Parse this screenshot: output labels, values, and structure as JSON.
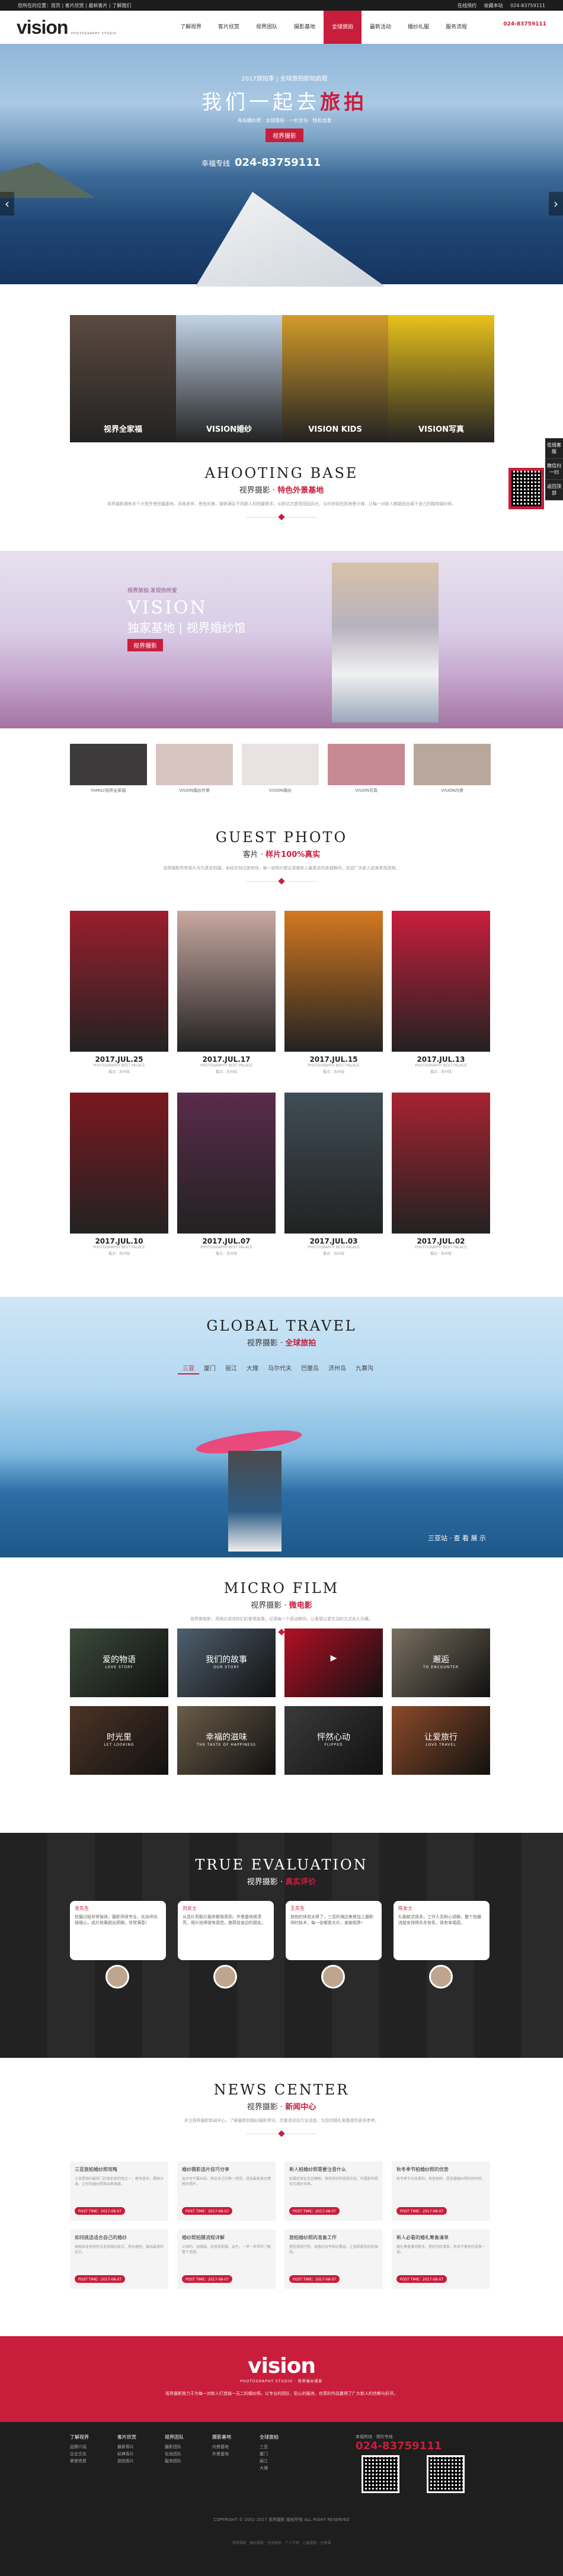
{
  "topbar": {
    "left": "您所在的位置：首页 | 客片欣赏 | 最新客片 | 了解我们",
    "links": [
      "在线预约",
      "收藏本站",
      "024-83759111"
    ]
  },
  "header": {
    "logo": "vision",
    "logo_sub": "PHOTOGRAPHY STUDIO",
    "nav": [
      "了解视界",
      "客片欣赏",
      "视界团队",
      "摄影基地",
      "全球旅拍",
      "最新活动",
      "婚纱礼服",
      "服务流程"
    ],
    "nav_active_index": 4,
    "phone": "024-83759111"
  },
  "hero": {
    "small": "2017旅拍季 | 全球旅拍即刻启程",
    "title_a": "我们一起去",
    "title_b": "旅拍",
    "line": "海岛婚纱照 · 全球旅拍 · 一价全包 · 轻松出发",
    "btn": "视界摄影",
    "phone_label": "幸福专线",
    "phone": "024-83759111",
    "prev": "‹",
    "next": "›"
  },
  "categories": [
    {
      "label": "视界全家福",
      "bg": "#5b4a40"
    },
    {
      "label": "VISION婚纱",
      "bg": "#c3d4e8"
    },
    {
      "label": "VISION KIDS",
      "bg": "#d39c2a"
    },
    {
      "label": "VISION写真",
      "bg": "#e9c21b"
    }
  ],
  "float_side": [
    "在线客服",
    "微信扫一扫",
    "返回顶部"
  ],
  "shooting": {
    "en": "AHOOTING BASE",
    "cn_a": "视界摄影 · ",
    "cn_b": "特色外景基地",
    "desc": "视界摄影拥有多个大型外景拍摄基地，风格多样，景色优美，能够满足不同新人的拍摄需求。从欧式古堡到田园风光，从时尚街拍到海景沙滩，让每一对新人都能拍出属于自己的独特婚纱照。"
  },
  "banner2": {
    "tag": "视界旅拍·发现你所爱",
    "v": "VISION",
    "l": "独家基地 | 视界婚纱馆",
    "btn": "视界摄影"
  },
  "base_thumbs": [
    "FAMILY视界全家福",
    "VISION婚纱外景",
    "VISION婚纱",
    "VISION写真",
    "VISION内景"
  ],
  "guest": {
    "en": "GUEST PHOTO",
    "cn_a": "客片 · ",
    "cn_b": "样片100%真实",
    "desc": "视界摄影所有客片均为真实拍摄，未经任何过度修饰，每一张照片都记录着新人最真实的幸福瞬间，欢迎广大新人前来参观选购。"
  },
  "photos_row1": [
    {
      "date": "2017.JUL.25",
      "sub": "PHOTOGRAPHY BEST PALACE",
      "loc": "摄点：苏州馆",
      "bg": "#9b1e2c"
    },
    {
      "date": "2017.JUL.17",
      "sub": "PHOTOGRAPHY BEST PALACE",
      "loc": "摄点：苏州馆",
      "bg": "#c9a8a1"
    },
    {
      "date": "2017.JUL.15",
      "sub": "PHOTOGRAPHY BEST PALACE",
      "loc": "摄点：苏州馆",
      "bg": "#d37820"
    },
    {
      "date": "2017.JUL.13",
      "sub": "PHOTOGRAPHY BEST PALACE",
      "loc": "摄点：苏州馆",
      "bg": "#c81e3c"
    }
  ],
  "photos_row2": [
    {
      "date": "2017.JUL.10",
      "sub": "PHOTOGRAPHY BEST PALACE",
      "loc": "摄点：苏州馆",
      "bg": "#7a1820"
    },
    {
      "date": "2017.JUL.07",
      "sub": "PHOTOGRAPHY BEST PALACE",
      "loc": "摄点：苏州馆",
      "bg": "#5b2b4b"
    },
    {
      "date": "2017.JUL.03",
      "sub": "PHOTOGRAPHY BEST PALACE",
      "loc": "摄点：苏州馆",
      "bg": "#3f4d55"
    },
    {
      "date": "2017.JUL.02",
      "sub": "PHOTOGRAPHY BEST PALACE",
      "loc": "摄点：苏州馆",
      "bg": "#a72330"
    }
  ],
  "travel": {
    "en": "GLOBAL TRAVEL",
    "cn_a": "视界摄影 · ",
    "cn_b": "全球旅拍",
    "tabs": [
      "三亚",
      "厦门",
      "丽江",
      "大理",
      "马尔代夫",
      "巴厘岛",
      "济州岛",
      "九寨沟"
    ],
    "tab_active": 0,
    "sign": "三亚站 · 查 看 展 示"
  },
  "film": {
    "en": "MICRO FILM",
    "cn_a": "视界摄影 · ",
    "cn_b": "微电影",
    "desc": "视界微电影，用镜头讲述你们的爱情故事，记录每一个感动瞬间，让爱情以更生动的方式永久珍藏。",
    "items": [
      {
        "t": "爱的物语",
        "e": "LOVE STORY",
        "bg": "#3b4a3a"
      },
      {
        "t": "我们的故事",
        "e": "OUR STORY",
        "bg": "#4f5f6e"
      },
      {
        "t": "▶",
        "e": "",
        "bg": "#b31024"
      },
      {
        "t": "邂逅",
        "e": "TO ENCOUNTER",
        "bg": "#7a7060"
      },
      {
        "t": "时光里",
        "e": "LET LOOKING",
        "bg": "#4d3426"
      },
      {
        "t": "幸福的滋味",
        "e": "THE TASTE OF HAPPINESS",
        "bg": "#6a5c48"
      },
      {
        "t": "怦然心动",
        "e": "FLIPPED",
        "bg": "#3a3a3a"
      },
      {
        "t": "让爱旅行",
        "e": "LOVE TRAVEL",
        "bg": "#8c4a2a"
      }
    ]
  },
  "eval": {
    "en": "TRUE EVALUATION",
    "cn_a": "视界摄影 · ",
    "cn_b": "真实评价",
    "cards": [
      {
        "nm": "张先生",
        "txt": "拍摄过程非常愉快，摄影师很专业，化妆师也很细心，成片效果超出预期，非常满意！"
      },
      {
        "nm": "刘女士",
        "txt": "从选片到取片服务都很周到，外景基地很漂亮，照片拍得很有感觉，推荐给身边的朋友。"
      },
      {
        "nm": "王先生",
        "txt": "旅拍的体验太棒了，三亚的海边美景加上摄影师的技术，每一张都是大片，谢谢视界！"
      },
      {
        "nm": "陈女士",
        "txt": "礼服款式很多，工作人员耐心讲解，整个拍摄流程安排得井井有条，很有幸福感。"
      }
    ]
  },
  "news": {
    "en": "NEWS CENTER",
    "cn_a": "视界摄影 · ",
    "cn_b": "新闻中心",
    "desc": "关注视界摄影新闻中心，了解最新的婚纱摄影资讯、优惠活动及行业动态，为您的婚礼筹备提供更多参考。",
    "items": [
      {
        "t": "三亚旅拍婚纱照攻略",
        "d": "三亚是国内最热门的旅拍目的地之一，碧海蓝天，椰林沙滩，让你的婚纱照美出新高度。",
        "pt": "POST TIME：2017-08-07"
      },
      {
        "t": "婚纱摄影选片技巧分享",
        "d": "选片时不要纠结，相信自己的第一感觉，挑选最能表达情感的照片。",
        "pt": "POST TIME：2017-08-07"
      },
      {
        "t": "新人拍婚纱照需要注意什么",
        "d": "拍摄前保证充足睡眠，保持良好的皮肤状态，和摄影师提前沟通好风格。",
        "pt": "POST TIME：2017-08-07"
      },
      {
        "t": "秋冬季节拍婚纱照的优势",
        "d": "秋冬季节光线柔和，景色独特，是拍摄婚纱照的好时机。",
        "pt": "POST TIME：2017-08-07"
      },
      {
        "t": "如何挑选适合自己的婚纱",
        "d": "根据自身身材特点选择婚纱款式，扬长避短，展现最美的自己。",
        "pt": "POST TIME：2017-08-07"
      },
      {
        "t": "婚纱照拍摄流程详解",
        "d": "从预约、选服装、化妆到拍摄、选片，一步一步带你了解整个流程。",
        "pt": "POST TIME：2017-08-07"
      },
      {
        "t": "旅拍婚纱照的准备工作",
        "d": "提前规划行程，准备好证件和必需品，让旅拍更加轻松愉快。",
        "pt": "POST TIME：2017-08-07"
      },
      {
        "t": "新人必看的婚礼筹备清单",
        "d": "婚礼筹备事项繁多，提前列好清单，有条不紊地完成每一项。",
        "pt": "POST TIME：2017-08-07"
      }
    ]
  },
  "footer": {
    "logo": "vision",
    "sub": "PHOTOGRAPHY STUDIO · 视界婚纱摄影",
    "desc": "视界摄影致力于为每一对新人打造独一无二的婚纱照，以专业的团队、贴心的服务、优质的作品赢得了广大新人的信赖与好评。",
    "cols": [
      {
        "h": "了解视界",
        "items": [
          "品牌介绍",
          "企业文化",
          "荣誉资质"
        ]
      },
      {
        "h": "客片欣赏",
        "items": [
          "最新客片",
          "经典客片",
          "旅拍客片"
        ]
      },
      {
        "h": "视界团队",
        "items": [
          "摄影团队",
          "化妆团队",
          "服务团队"
        ]
      },
      {
        "h": "摄影基地",
        "items": [
          "内景基地",
          "外景基地"
        ]
      },
      {
        "h": "全球旅拍",
        "items": [
          "三亚",
          "厦门",
          "丽江",
          "大理"
        ]
      }
    ],
    "phone_label": "幸福热线 · 预约专线",
    "phone": "024-83759111",
    "copyright": "COPYRIGHT © 2001-2017 视界摄影 版权所有 ALL RIGHT RESERVED",
    "bottom": "视界摄影 · 婚纱摄影 · 全球旅拍 · 个人写真 · 儿童摄影 · 全家福"
  }
}
